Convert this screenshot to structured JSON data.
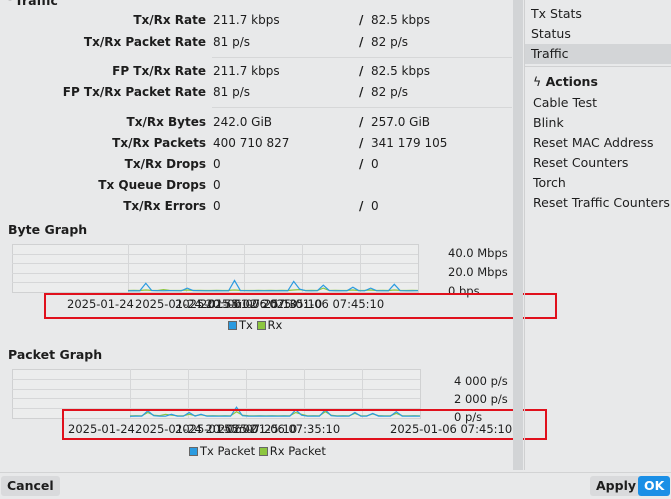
{
  "section_title": "Traffic",
  "stats": [
    {
      "label": "Tx/Rx Rate",
      "tx": "211.7 kbps",
      "rx": "82.5 kbps"
    },
    {
      "label": "Tx/Rx Packet Rate",
      "tx": "81 p/s",
      "rx": "82 p/s"
    },
    {
      "label": "FP Tx/Rx Rate",
      "tx": "211.7 kbps",
      "rx": "82.5 kbps"
    },
    {
      "label": "FP Tx/Rx Packet Rate",
      "tx": "81 p/s",
      "rx": "82 p/s"
    },
    {
      "label": "Tx/Rx Bytes",
      "tx": "242.0 GiB",
      "rx": "257.0 GiB"
    },
    {
      "label": "Tx/Rx Packets",
      "tx": "400 710 827",
      "rx": "341 179 105"
    },
    {
      "label": "Tx/Rx Drops",
      "tx": "0",
      "rx": "0"
    },
    {
      "label": "Tx Queue Drops",
      "tx": "0"
    },
    {
      "label": "Tx/Rx Errors",
      "tx": "0",
      "rx": "0"
    }
  ],
  "separator": "/",
  "sidebar": {
    "tabs": [
      "Tx Stats",
      "Status",
      "Traffic"
    ],
    "active": "Traffic",
    "actions_title": "Actions",
    "actions": [
      "Cable Test",
      "Blink",
      "Reset MAC Address",
      "Reset Counters",
      "Torch",
      "Reset Traffic Counters"
    ]
  },
  "footer": {
    "cancel": "Cancel",
    "apply": "Apply",
    "ok": "OK"
  },
  "colors": {
    "tx": "#2b9be0",
    "rx": "#8cc63f",
    "ok": "#1a8fe6",
    "highlight": "#e0101c"
  },
  "chart_data": [
    {
      "type": "line",
      "title": "Byte Graph",
      "ylim": [
        0,
        50
      ],
      "yticks": [
        "40.0 Mbps",
        "20.0 Mbps",
        "0 bps"
      ],
      "ytick_values": [
        40,
        20,
        0
      ],
      "xticks": [
        "2025-01-24",
        "2025-01-24 20:55:02",
        "2025-01-06 07:25:10",
        "2025-01-06 07:35:10",
        "2025-01-06 07:45:10"
      ],
      "series": [
        {
          "name": "Tx",
          "values": [
            0.2,
            0.3,
            0.2,
            8,
            0.5,
            0.3,
            0.2,
            0.4,
            0.3,
            0.2,
            3,
            0.5,
            0.3,
            0.2,
            0.2,
            0.3,
            0.2,
            0.2,
            11,
            0.4,
            0.3,
            0.2,
            0.3,
            0.2,
            0.3,
            0.2,
            0.3,
            0.2,
            10,
            2,
            0.3,
            0.2,
            0.3,
            6,
            0.5,
            0.2,
            0.3,
            0.2,
            4,
            0.3,
            0.2,
            3,
            0.3,
            0.2,
            0.2,
            7,
            0.3,
            0.2,
            0.2,
            0.3
          ]
        },
        {
          "name": "Rx",
          "values": [
            0.5,
            0.6,
            0.5,
            1,
            0.6,
            0.5,
            1.5,
            0.6,
            0.5,
            0.6,
            1,
            0.5,
            0.6,
            0.5,
            0.5,
            0.6,
            0.5,
            0.6,
            1,
            0.6,
            0.5,
            0.5,
            0.6,
            0.5,
            0.6,
            0.5,
            0.6,
            0.5,
            1,
            1.5,
            0.5,
            0.6,
            0.5,
            3,
            0.5,
            0.6,
            0.5,
            0.6,
            1,
            0.5,
            0.6,
            1,
            0.5,
            0.6,
            0.5,
            1,
            0.6,
            0.5,
            0.6,
            0.5
          ]
        }
      ]
    },
    {
      "type": "line",
      "title": "Packet Graph",
      "ylim": [
        0,
        5500
      ],
      "yticks": [
        "4 000 p/s",
        "2 000 p/s",
        "0 p/s"
      ],
      "ytick_values": [
        4000,
        2000,
        0
      ],
      "xticks": [
        "2025-01-24",
        "2025-01-24 20:55:02",
        "2025-01-06 07:25:10",
        "2025-01-06 07:35:10",
        "2025-01-06 07:45:10"
      ],
      "series": [
        {
          "name": "Tx Packet",
          "values": [
            80,
            100,
            90,
            700,
            150,
            100,
            90,
            300,
            100,
            90,
            500,
            100,
            300,
            90,
            100,
            90,
            100,
            90,
            1100,
            150,
            100,
            90,
            100,
            90,
            100,
            90,
            100,
            90,
            800,
            200,
            90,
            100,
            90,
            800,
            150,
            90,
            100,
            90,
            500,
            100,
            90,
            400,
            100,
            90,
            100,
            600,
            100,
            90,
            100,
            90
          ]
        },
        {
          "name": "Rx Packet",
          "values": [
            120,
            150,
            130,
            500,
            200,
            150,
            300,
            200,
            150,
            130,
            300,
            150,
            250,
            130,
            150,
            130,
            150,
            130,
            600,
            200,
            150,
            130,
            150,
            130,
            150,
            130,
            150,
            130,
            500,
            300,
            130,
            150,
            130,
            600,
            200,
            130,
            150,
            130,
            400,
            150,
            130,
            350,
            150,
            130,
            150,
            400,
            150,
            130,
            150,
            130
          ]
        }
      ]
    }
  ]
}
